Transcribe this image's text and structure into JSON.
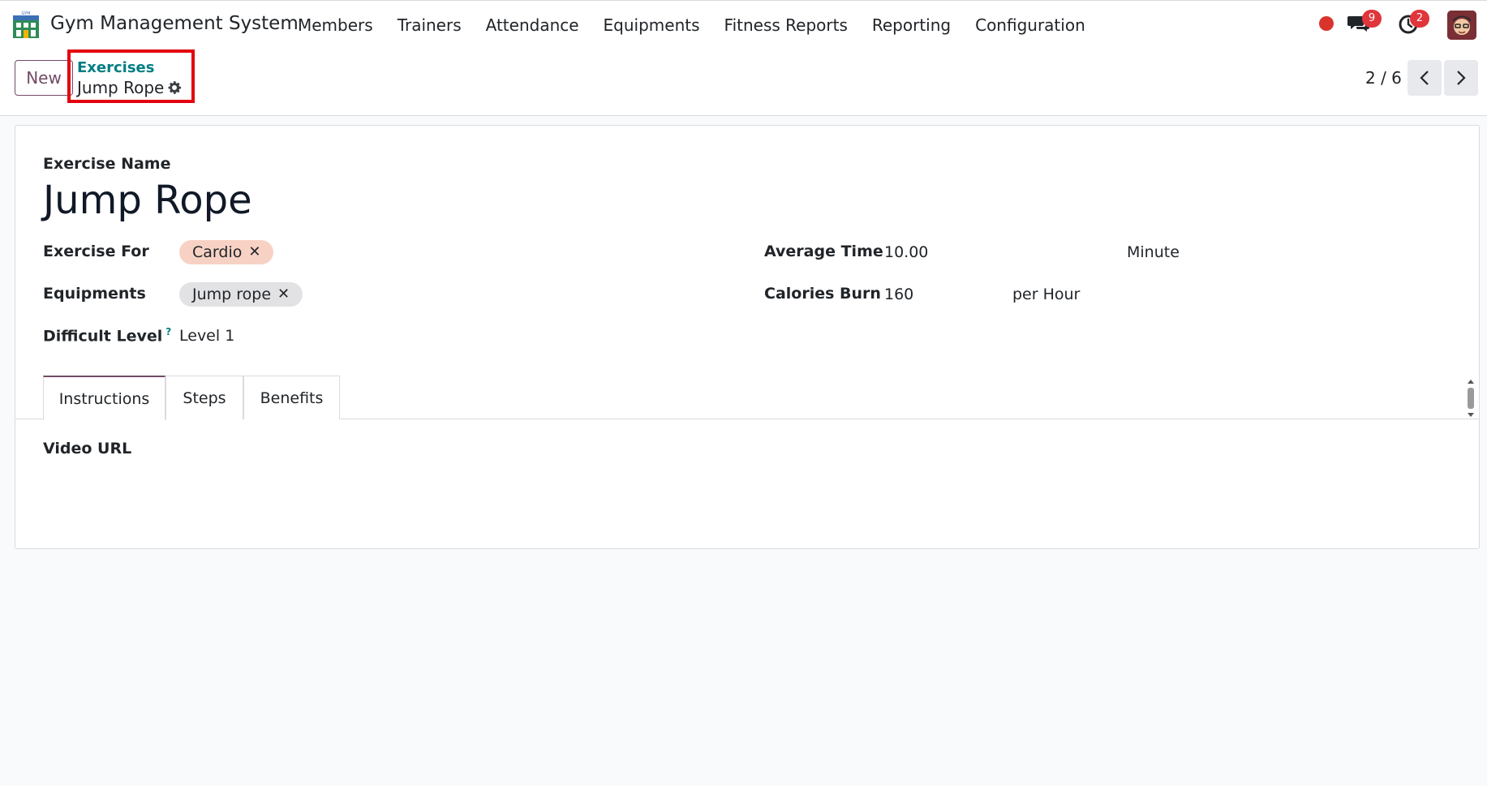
{
  "navbar": {
    "app_title": "Gym Management System",
    "logo_text": "GYM",
    "menu": [
      "Members",
      "Trainers",
      "Attendance",
      "Equipments",
      "Fitness Reports",
      "Reporting",
      "Configuration"
    ],
    "chat_badge": "9",
    "activity_badge": "2"
  },
  "control": {
    "new_label": "New",
    "breadcrumb_parent": "Exercises",
    "breadcrumb_current": "Jump Rope",
    "pager": "2 / 6"
  },
  "form": {
    "exercise_name_label": "Exercise Name",
    "exercise_name": "Jump Rope",
    "exercise_for_label": "Exercise For",
    "exercise_for_tag": "Cardio",
    "equipments_label": "Equipments",
    "equipments_tag": "Jump rope",
    "difficult_level_label": "Difficult Level",
    "difficult_level_help": "?",
    "difficult_level": "Level 1",
    "average_time_label": "Average Time",
    "average_time": "10.00",
    "average_time_unit": "Minute",
    "calories_burn_label": "Calories Burn",
    "calories_burn": "160",
    "calories_burn_unit": "per Hour"
  },
  "tabs": [
    "Instructions",
    "Steps",
    "Benefits"
  ],
  "instructions": {
    "video_url_label": "Video URL"
  },
  "colors": {
    "brand": "#714b67",
    "link": "#017e84",
    "highlight": "#e3000f",
    "badge": "#e0353a",
    "cardio_tag": "#f7d2c4",
    "equipment_tag": "#e2e2e5"
  }
}
